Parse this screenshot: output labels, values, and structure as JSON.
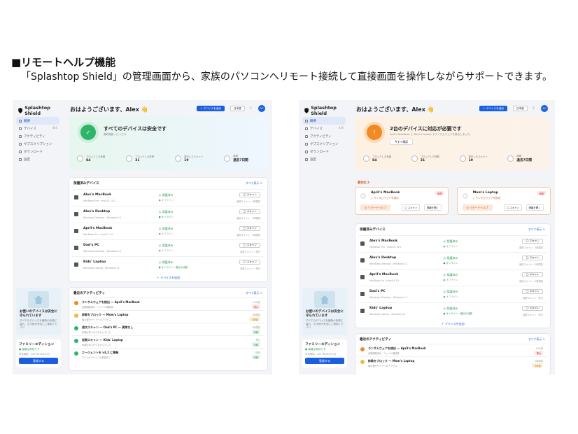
{
  "heading": "■リモートヘルプ機能",
  "description": "「Splashtop Shield」の管理画面から、家族のパソコンへリモート接続して直接画面を操作しながらサポートできます。",
  "common": {
    "brand": "Splashtop Shield",
    "nav": [
      {
        "label": "概要",
        "count": ""
      },
      {
        "label": "デバイス",
        "count": "4/4"
      },
      {
        "label": "アクティビティ",
        "count": ""
      },
      {
        "label": "サブスクリプション",
        "count": ""
      },
      {
        "label": "ダウンロード",
        "count": ""
      },
      {
        "label": "設定",
        "count": ""
      }
    ],
    "help_title": "お使いのデバイスは安全に守られています",
    "help_sub": "すべてのデバイスを最新の状態に保ち、引き続き安全にご使用ください",
    "plan_title": "ファミリーエディション",
    "plan_status": "● 保護は有効です",
    "plan_date": "有効期限：2027年12月31日",
    "plan_button": "登録する",
    "greeting": "おはようございます、Alex 👋",
    "add_device": "＋ デバイスを追加",
    "language": "日本語",
    "avatar": "AC",
    "stats_labels": [
      "ブロックした脅威",
      "ブロックした詐欺",
      "実行したスキャン",
      "時間"
    ],
    "stats_values": [
      "84",
      "31",
      "19",
      "過去7日間"
    ],
    "devices_title": "保護済みデバイス",
    "devices_all": "すべて表示 >",
    "scan_label": "◯ スキャン",
    "add_device_link": "＋ デバイスを追加",
    "activity_title": "最近のアクティビティ",
    "activity_all": "すべて表示 >"
  },
  "left": {
    "hero_title": "すべてのデバイスは安全です",
    "hero_sub": "最終確認：たった今",
    "devices": [
      {
        "name": "Alex's MacBook",
        "os": "MacBook Pro・macOS 14.1",
        "status": "◎ 保護済み",
        "online": "● オフライン",
        "last": "最終スキャン：3時間前"
      },
      {
        "name": "Alex's Desktop",
        "os": "Windows Desktop・Windows 11",
        "status": "◎ 保護済み",
        "online": "● オンライン",
        "last": "最終スキャン：1時間前"
      },
      {
        "name": "April's MacBook",
        "os": "MacBook Air・macOS 14",
        "status": "◎ 保護済み",
        "online": "● オフライン",
        "last": "最終スキャン：2時間前"
      },
      {
        "name": "Dad's PC",
        "os": "Windows Desktop・Windows 11",
        "status": "◎ 保護済み",
        "online": "● オフライン",
        "last": "最終スキャン：昨日"
      },
      {
        "name": "Kids' Laptop",
        "os": "Windows Laptop・Windows 11",
        "status": "◎ 保護済み",
        "online": "● オンライン・最近の活動",
        "last": "最終スキャン：昨日"
      }
    ],
    "activities": [
      {
        "title": "ランサムウェアを検出 — April's MacBook",
        "sub": "自動隔離済み・ファイル確認済",
        "time": "10分前",
        "tag": "重大"
      },
      {
        "title": "詐欺をブロック — Mom's Laptop",
        "sub": "偽の銀行サイトへのアクセス",
        "time": "1時間前",
        "tag": "中程度"
      },
      {
        "title": "週次スキャン — Dad's PC — 異常なし",
        "sub": "脅威は見つかりませんでした",
        "time": "3時間前",
        "tag": "情報"
      },
      {
        "title": "定期スキャン — Kids' Laptop",
        "sub": "脅威は見つかりませんでした",
        "time": "昨日",
        "tag": "情報"
      },
      {
        "title": "エージェントを v3.2 に更新",
        "sub": "すべてのデバイスで更新完了",
        "time": "2日前",
        "tag": "情報"
      }
    ]
  },
  "right": {
    "hero_title": "2台のデバイスに対応が必要です",
    "hero_sub": "April's MacBook と Mom's Laptop でランサムウェアを検出しました。",
    "hero_button": "今すぐ確認",
    "attention_label": "要対応 2",
    "attention": [
      {
        "name": "April's MacBook",
        "warning": "△ ランサムウェアを検出",
        "badge": "危険",
        "remote": "◎ リモートヘルプ",
        "scan": "◯ スキャン",
        "detail": "隔離を開く"
      },
      {
        "name": "Mom's Laptop",
        "warning": "△ ランサムウェアを検出",
        "badge": "危険",
        "remote": "◎ リモートヘルプ",
        "scan": "◯ スキャン",
        "detail": "隔離を開く"
      }
    ],
    "devices": [
      {
        "name": "Alex's MacBook",
        "os": "MacBook Pro・macOS 14.1",
        "status": "◎ 保護済み",
        "online": "● オフライン",
        "last": "最終スキャン：3時間前"
      },
      {
        "name": "Alex's Desktop",
        "os": "Windows Desktop・Windows 11",
        "status": "◎ 保護済み",
        "online": "● オンライン",
        "last": "最終スキャン：1時間前"
      },
      {
        "name": "April's MacBook",
        "os": "MacBook Air・macOS 14",
        "status": "◎ 保護済み",
        "online": "● オフライン",
        "last": "最終スキャン：2時間前"
      },
      {
        "name": "Dad's PC",
        "os": "Windows Desktop・Windows 11",
        "status": "◎ 保護済み",
        "online": "● オフライン",
        "last": "最終スキャン：昨日"
      },
      {
        "name": "Kids' Laptop",
        "os": "Windows Laptop・Windows 11",
        "status": "◎ 保護済み",
        "online": "● オンライン・最近の活動",
        "last": "最終スキャン：昨日"
      }
    ],
    "activities": [
      {
        "title": "ランサムウェアを検出 — April's MacBook",
        "sub": "自動隔離済み・ファイル確認済",
        "time": "10分前",
        "tag": "重大"
      },
      {
        "title": "詐欺をブロック — Mom's Laptop",
        "sub": "偽の銀行サイトへのアクセス",
        "time": "1時間前",
        "tag": "中程度"
      }
    ]
  },
  "colors": {
    "accent": "#1b5fe0",
    "safe": "#2fb56a",
    "warn": "#f08a24",
    "danger": "#d22233"
  }
}
